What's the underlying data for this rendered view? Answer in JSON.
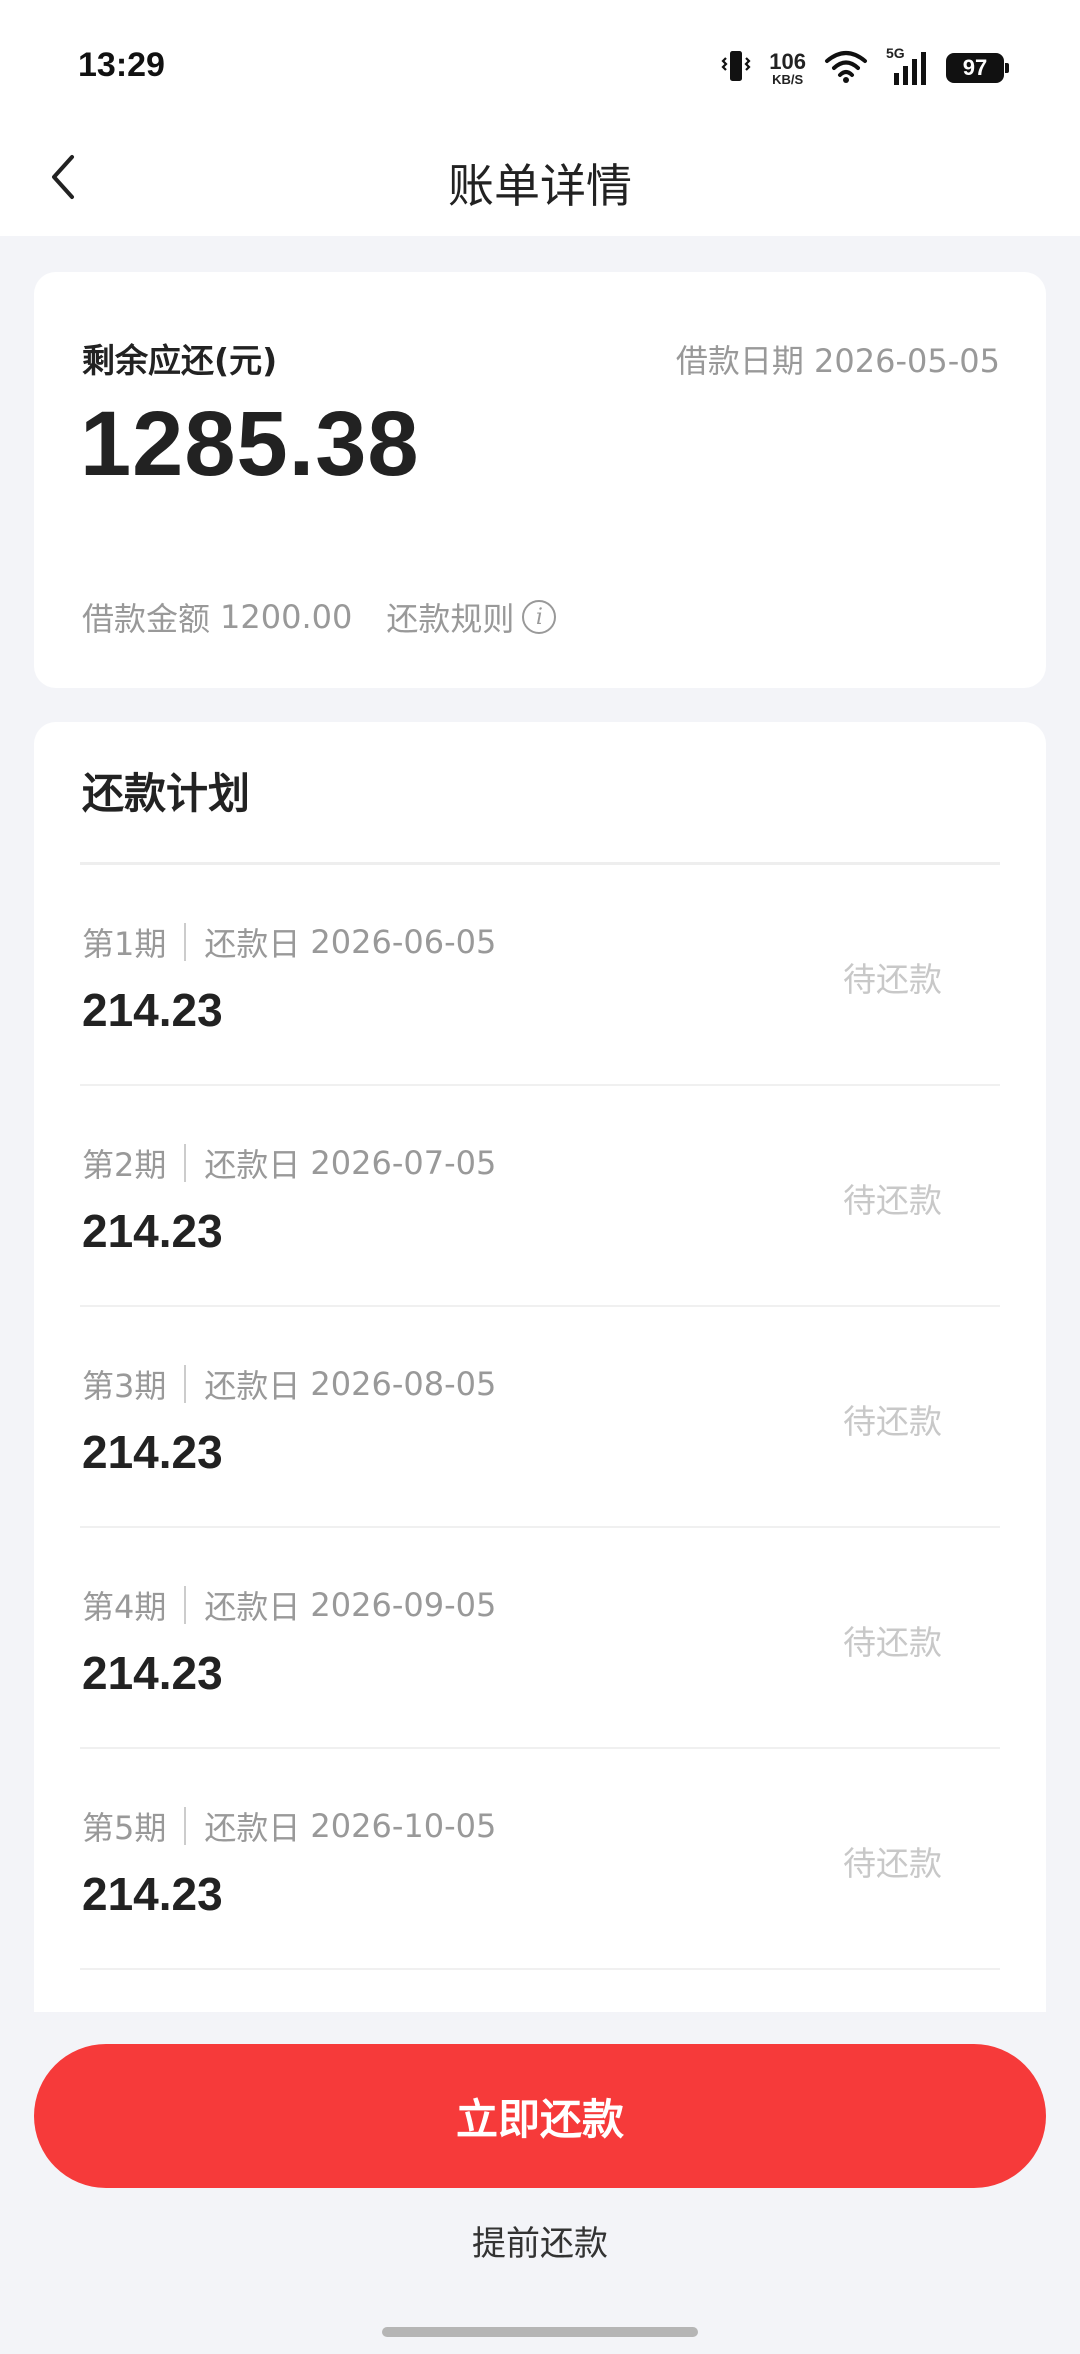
{
  "status_bar": {
    "time": "13:29",
    "net_speed_value": "106",
    "net_speed_unit": "KB/S",
    "network_type": "5G",
    "battery": "97"
  },
  "header": {
    "title": "账单详情"
  },
  "summary": {
    "remain_label": "剩余应还(元)",
    "loan_date_label": "借款日期",
    "loan_date": "2026-05-05",
    "remain_amount": "1285.38",
    "loan_amount_label": "借款金额",
    "loan_amount": "1200.00",
    "repay_rule_label": "还款规则"
  },
  "plan": {
    "title": "还款计划",
    "due_label": "还款日",
    "items": [
      {
        "period": "第1期",
        "date": "2026-06-05",
        "amount": "214.23",
        "status": "待还款"
      },
      {
        "period": "第2期",
        "date": "2026-07-05",
        "amount": "214.23",
        "status": "待还款"
      },
      {
        "period": "第3期",
        "date": "2026-08-05",
        "amount": "214.23",
        "status": "待还款"
      },
      {
        "period": "第4期",
        "date": "2026-09-05",
        "amount": "214.23",
        "status": "待还款"
      },
      {
        "period": "第5期",
        "date": "2026-10-05",
        "amount": "214.23",
        "status": "待还款"
      }
    ]
  },
  "actions": {
    "pay_now": "立即还款",
    "prepay": "提前还款"
  },
  "colors": {
    "accent": "#f63a3a",
    "page_bg": "#f3f4f8"
  }
}
